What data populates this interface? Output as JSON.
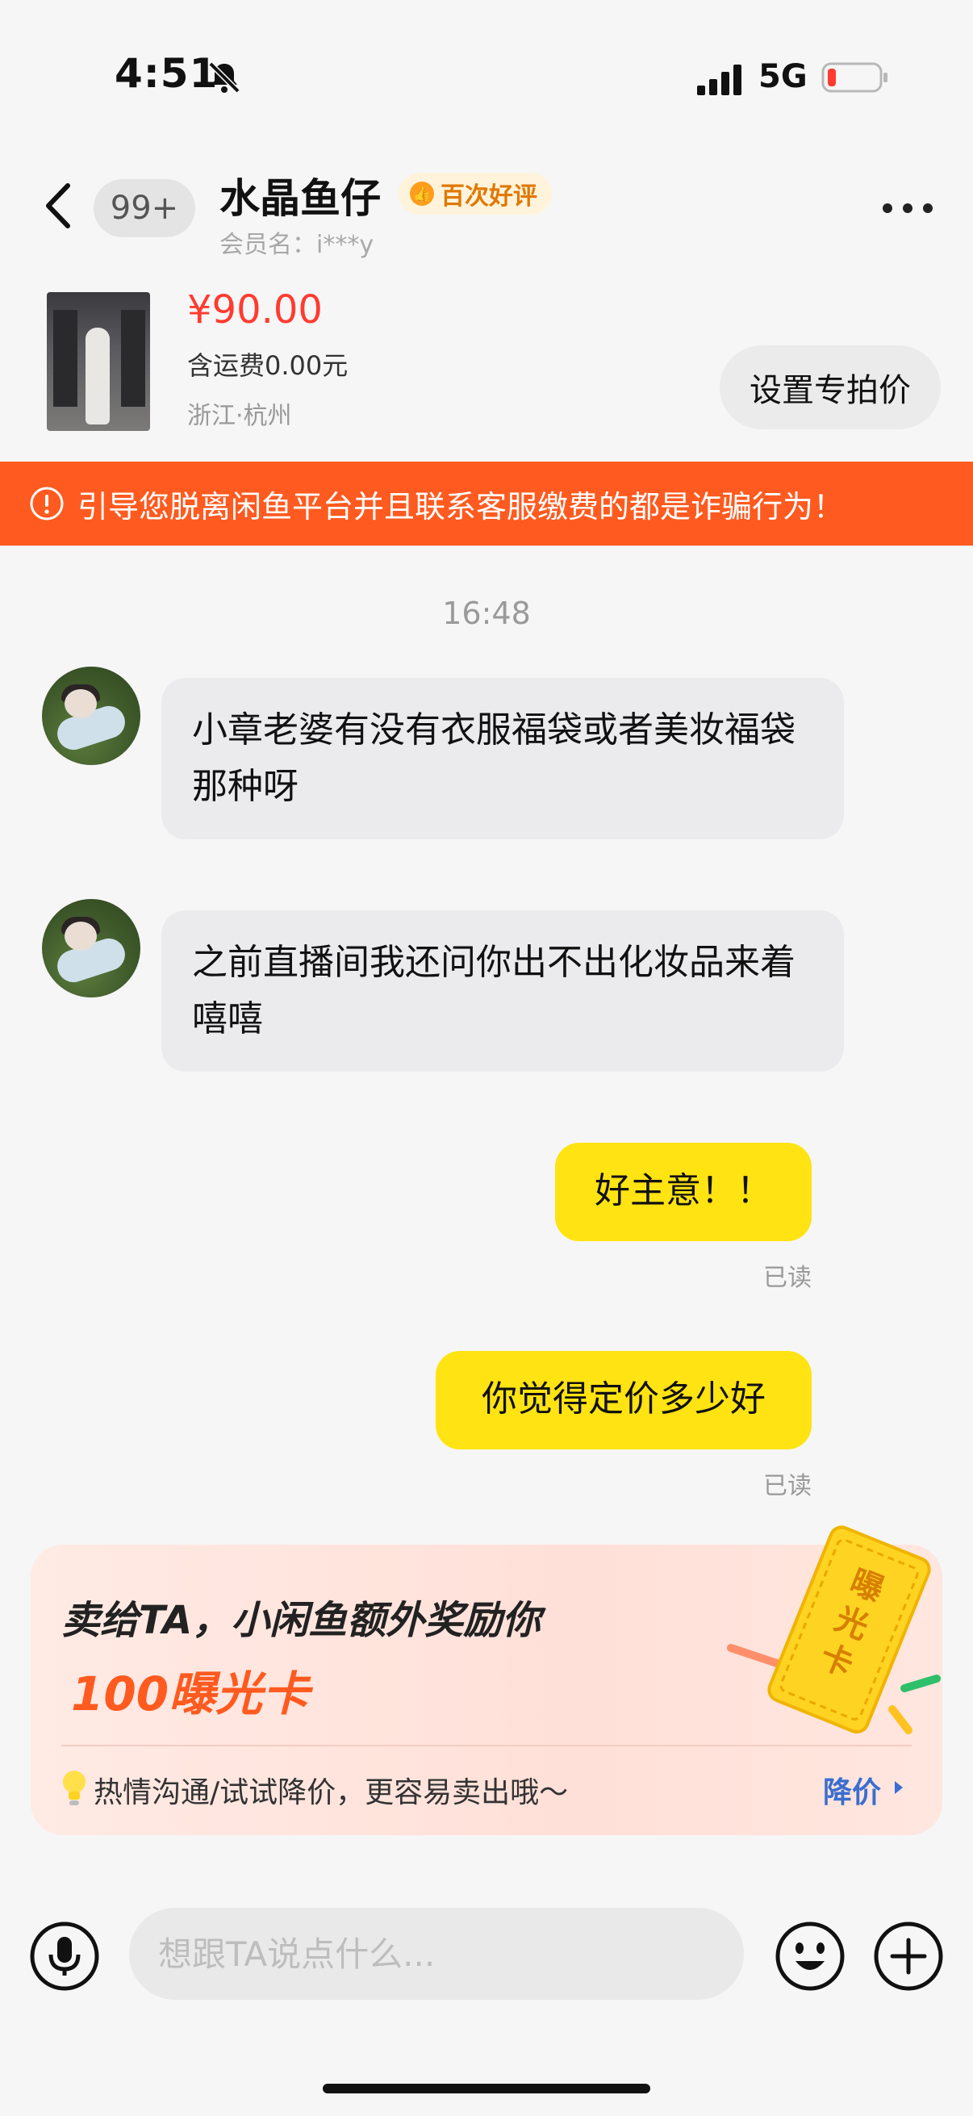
{
  "status_bar": {
    "time": "4:51",
    "network": "5G",
    "icons": [
      "bell-slash-icon",
      "signal-icon",
      "battery-low-icon"
    ]
  },
  "header": {
    "unread_count": "99+",
    "contact_name": "水晶鱼仔",
    "rating_badge": "百次好评",
    "member_label": "会员名：",
    "member_id": "i***y"
  },
  "product": {
    "price": "¥90.00",
    "shipping": "含运费0.00元",
    "location": "浙江·杭州",
    "set_price_button": "设置专拍价"
  },
  "warning": {
    "text": "引导您脱离闲鱼平台并且联系客服缴费的都是诈骗行为！",
    "color": "#ff5a1f"
  },
  "chat": {
    "time_divider": "16:48",
    "messages": [
      {
        "side": "in",
        "text": "小章老婆有没有衣服福袋或者美妆福袋那种呀"
      },
      {
        "side": "in",
        "text": "之前直播间我还问你出不出化妆品来着嘻嘻"
      },
      {
        "side": "out",
        "text": "好主意！！",
        "status": "已读"
      },
      {
        "side": "out",
        "text": "你觉得定价多少好",
        "status": "已读"
      }
    ]
  },
  "promo": {
    "title": "卖给TA，小闲鱼额外奖励你",
    "highlight": "100曝光卡",
    "ticket_text": "曝光卡",
    "tip": "热情沟通/试试降价，更容易卖出哦～",
    "action": "降价"
  },
  "composer": {
    "placeholder": "想跟TA说点什么..."
  },
  "colors": {
    "accent_yellow": "#ffe312",
    "price_red": "#ff3b30",
    "link_blue": "#3a6ecf"
  }
}
